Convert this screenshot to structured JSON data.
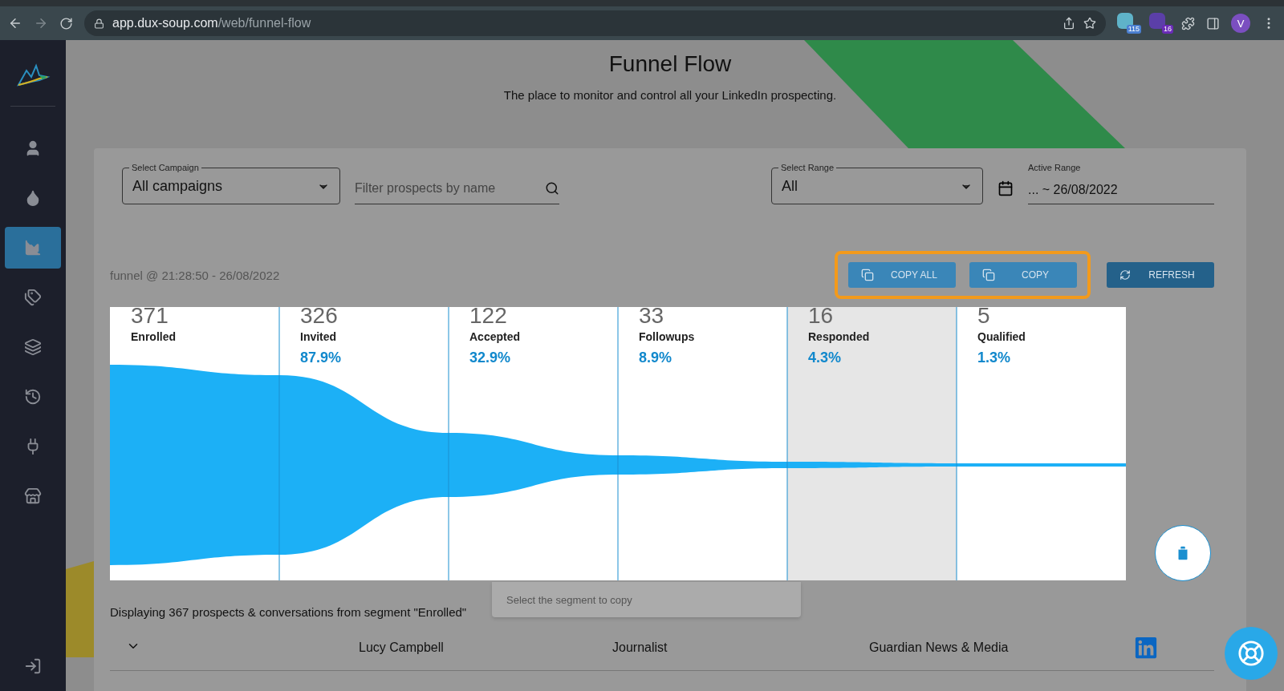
{
  "browser": {
    "url_host": "app.dux-soup.com",
    "url_path": "/web/funnel-flow",
    "extension_badges": [
      "115",
      "16"
    ],
    "avatar": "V"
  },
  "sidebar": {
    "items": [
      {
        "selected": false
      },
      {
        "selected": false
      },
      {
        "selected": true
      },
      {
        "selected": false
      },
      {
        "selected": false
      },
      {
        "selected": false
      },
      {
        "selected": false
      },
      {
        "selected": false
      }
    ]
  },
  "header": {
    "title": "Funnel Flow",
    "subtitle": "The place to monitor and control all your LinkedIn prospecting."
  },
  "filters": {
    "campaign": {
      "label": "Select Campaign",
      "value": "All campaigns"
    },
    "search": {
      "placeholder": "Filter prospects by name"
    },
    "range": {
      "label": "Select Range",
      "value": "All"
    },
    "active_range": {
      "label": "Active Range",
      "value": "... ~ 26/08/2022"
    }
  },
  "timestamp": "funnel @ 21:28:50 - 26/08/2022",
  "copy_buttons": {
    "outlined": true,
    "items": [
      {
        "label": "COPY ALL"
      },
      {
        "label": "COPY"
      }
    ]
  },
  "refresh_button": {
    "label": "REFRESH"
  },
  "funnel": {
    "stages": [
      {
        "count": "371",
        "label": "Enrolled",
        "selected": false
      },
      {
        "count": "326",
        "label": "Invited",
        "percent": "87.9%",
        "selected": false
      },
      {
        "count": "122",
        "label": "Accepted",
        "percent": "32.9%",
        "selected": false
      },
      {
        "count": "33",
        "label": "Followups",
        "percent": "8.9%",
        "selected": false
      },
      {
        "count": "16",
        "label": "Responded",
        "percent": "4.3%",
        "selected": true
      },
      {
        "count": "5",
        "label": "Qualified",
        "percent": "1.3%",
        "selected": false
      }
    ]
  },
  "tooltip": "Select the segment to copy",
  "summary": "Displaying 367 prospects & conversations from segment \"Enrolled\"",
  "rows": [
    {
      "expanded": false,
      "name": "Lucy Campbell",
      "title": "Journalist",
      "company": "Guardian News & Media"
    }
  ]
}
